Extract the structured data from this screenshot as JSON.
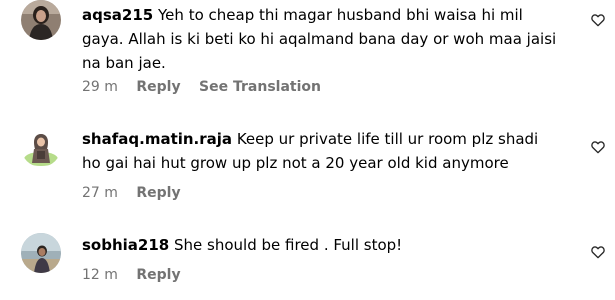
{
  "comments": [
    {
      "username": "aqsa215",
      "text": "Yeh to cheap thi magar husband bhi waisa hi mil gaya. Allah is ki beti ko hi aqalmand bana day or woh maa jaisi na ban jae.",
      "time": "29 m",
      "reply_label": "Reply",
      "translation_label": "See Translation"
    },
    {
      "username": "shafaq.matin.raja",
      "text": "Keep ur private life till ur room plz shadi ho gai hai hut grow up plz not a 20 year old kid anymore",
      "time": "27 m",
      "reply_label": "Reply"
    },
    {
      "username": "sobhia218",
      "text": "She should be fired . Full stop!",
      "time": "12 m",
      "reply_label": "Reply"
    }
  ],
  "icons": {
    "like": "heart-outline-icon"
  },
  "colors": {
    "text": "#000000",
    "meta": "#737373",
    "background": "#ffffff"
  }
}
